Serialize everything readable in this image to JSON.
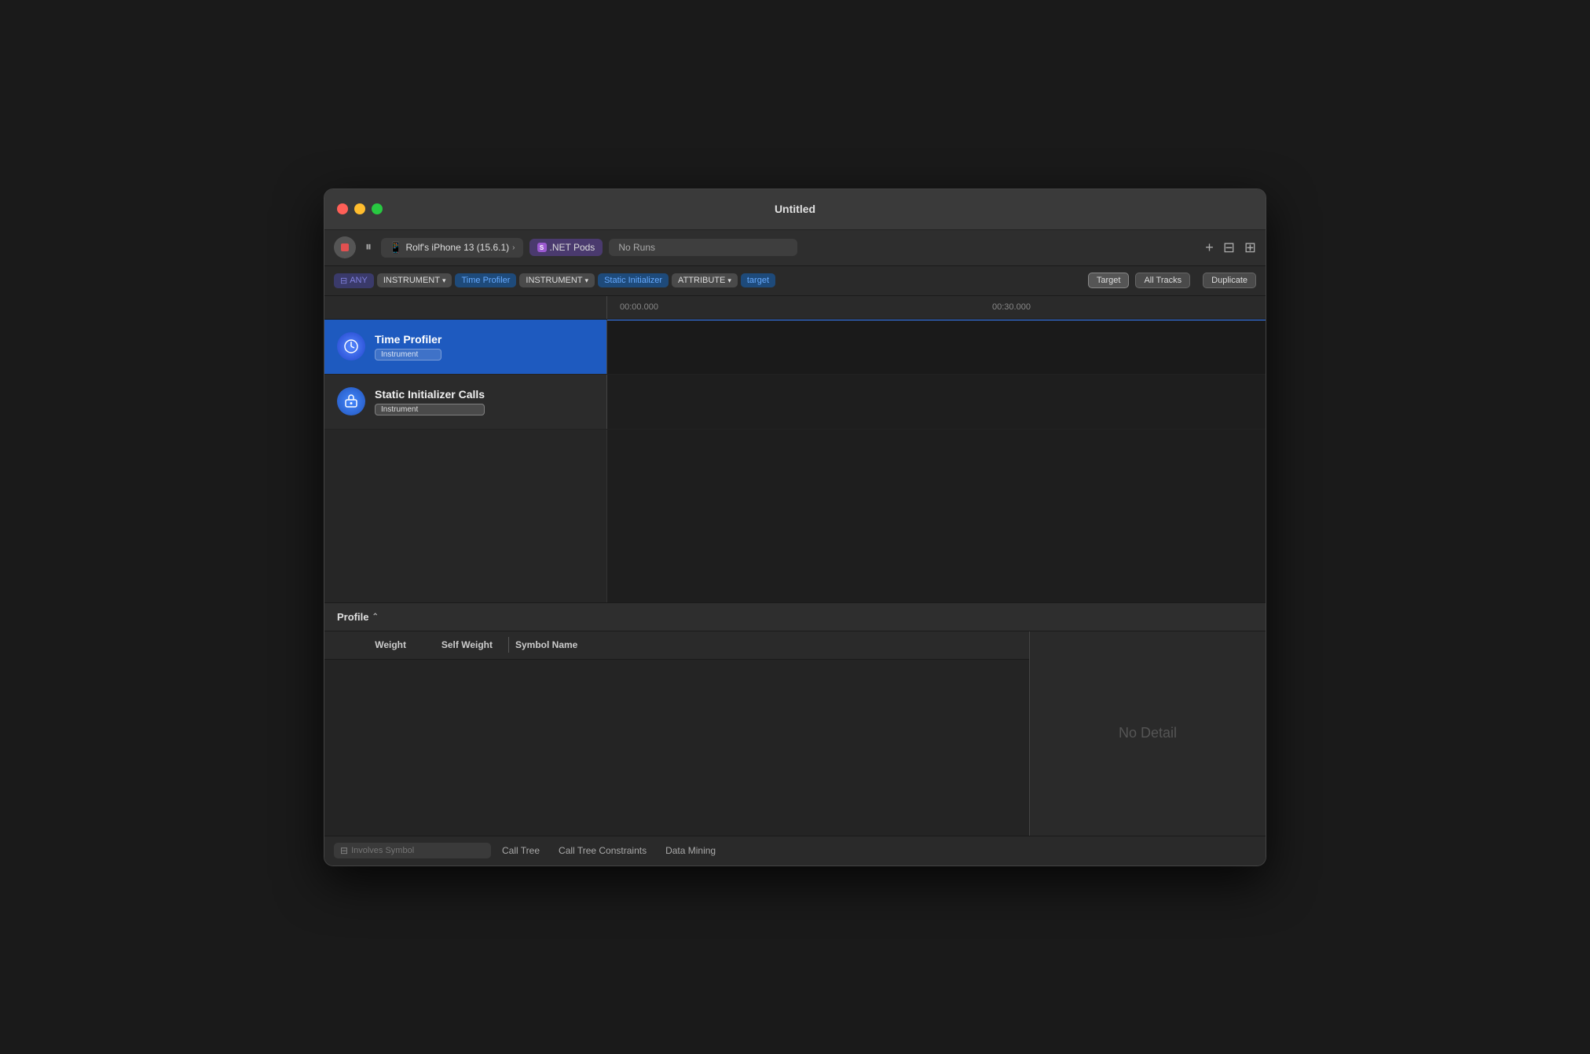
{
  "window": {
    "title": "Untitled"
  },
  "toolbar": {
    "pause_label": "⏸",
    "device_name": "Rolf's iPhone 13 (15.6.1)",
    "app_name": ".NET Pods",
    "runs_placeholder": "No Runs",
    "add_label": "+",
    "layout1_label": "⊟",
    "layout2_label": "⊞"
  },
  "filter_bar": {
    "any_label": "ANY",
    "instrument_label1": "INSTRUMENT",
    "time_profiler_label": "Time Profiler",
    "instrument_label2": "INSTRUMENT",
    "static_initializer_label": "Static Initializer",
    "attribute_label": "ATTRIBUTE",
    "target_label": "target",
    "filter_label": "Target",
    "all_tracks_label": "All Tracks",
    "duplicate_label": "Duplicate"
  },
  "timeline": {
    "mark1": "00:00.000",
    "mark2": "00:30.000"
  },
  "tracks": [
    {
      "id": "time-profiler",
      "name": "Time Profiler",
      "badge": "Instrument",
      "selected": true
    },
    {
      "id": "static-initializer",
      "name": "Static Initializer Calls",
      "badge": "Instrument",
      "selected": false
    }
  ],
  "bottom_panel": {
    "profile_label": "Profile",
    "profile_chevron": "⌃",
    "columns": {
      "weight": "Weight",
      "self_weight": "Self Weight",
      "symbol_name": "Symbol Name"
    },
    "no_detail": "No Detail"
  },
  "bottom_toolbar": {
    "search_placeholder": "Involves Symbol",
    "tab1": "Call Tree",
    "tab2": "Call Tree Constraints",
    "tab3": "Data Mining"
  }
}
